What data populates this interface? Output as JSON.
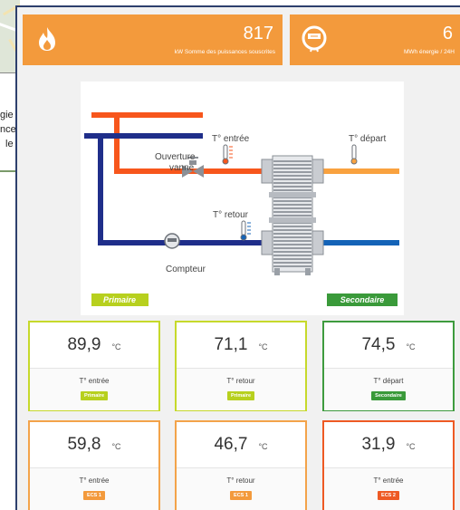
{
  "background_window": {
    "text_lines": [
      "gie",
      "nce",
      "le"
    ]
  },
  "kpis": [
    {
      "icon": "flame-icon",
      "value": "817",
      "caption": "kW Somme des puissances souscrites"
    },
    {
      "icon": "meter-icon",
      "value": "6",
      "caption": "MWh énergie / 24H"
    }
  ],
  "diagram": {
    "labels": {
      "t_entree": "T° entrée",
      "t_depart": "T° départ",
      "ouverture_vanne_1": "Ouverture",
      "ouverture_vanne_2": "vanne",
      "t_retour": "T° retour",
      "compteur": "Compteur",
      "primaire": "Primaire",
      "secondaire": "Secondaire"
    },
    "colors": {
      "primary_hot": "#f7561c",
      "primary_cold": "#1f2e8a",
      "secondary_hot": "#f9a23f",
      "secondary_cold": "#1463b7",
      "primaire_badge": "#b7d01e",
      "secondaire_badge": "#3a9a3a"
    }
  },
  "cards": [
    {
      "value": "89,9",
      "unit": "°C",
      "label": "T° entrée",
      "badge": "Primaire"
    },
    {
      "value": "71,1",
      "unit": "°C",
      "label": "T° retour",
      "badge": "Primaire"
    },
    {
      "value": "74,5",
      "unit": "°C",
      "label": "T° départ",
      "badge": "Secondaire"
    },
    {
      "value": "59,8",
      "unit": "°C",
      "label": "T° entrée",
      "badge": "ECS 1"
    },
    {
      "value": "46,7",
      "unit": "°C",
      "label": "T° retour",
      "badge": "ECS 1"
    },
    {
      "value": "31,9",
      "unit": "°C",
      "label": "T° entrée",
      "badge": "ECS 2"
    }
  ]
}
